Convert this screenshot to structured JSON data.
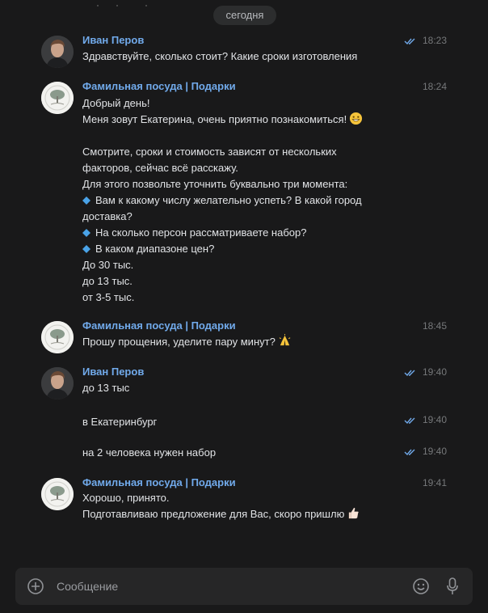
{
  "date_divider": "сегодня",
  "messages": [
    {
      "author": "Иван Перов",
      "time": "18:23",
      "read": true,
      "lines": [
        "Здравствуйте, сколько стоит? Какие сроки изготовления"
      ]
    },
    {
      "author": "Фамильная посуда | Подарки",
      "time": "18:24",
      "read": false,
      "lines": [
        "Добрый день!",
        "Меня зовут Екатерина, очень приятно познакомиться!",
        "",
        "Смотрите, сроки и стоимость зависят от нескольких",
        "факторов, сейчас всё расскажу.",
        "Для этого позвольте уточнить буквально три момента:",
        "Вам к какому числу желательно успеть? В какой город",
        "доставка?",
        "На сколько персон рассматриваете набор?",
        "В каком диапазоне цен?",
        "До 30 тыс.",
        "до 13 тыс.",
        "от 3-5 тыс."
      ]
    },
    {
      "author": "Фамильная посуда | Подарки",
      "time": "18:45",
      "read": false,
      "lines": [
        "Прошу прощения, уделите пару минут?"
      ]
    },
    {
      "author": "Иван Перов",
      "time": "19:40",
      "read": true,
      "lines": [
        "до 13 тыс"
      ]
    },
    {
      "time": "19:40",
      "read": true,
      "lines": [
        "в Екатеринбург"
      ]
    },
    {
      "time": "19:40",
      "read": true,
      "lines": [
        "на 2 человека нужен набор"
      ]
    },
    {
      "author": "Фамильная посуда | Подарки",
      "time": "19:41",
      "read": false,
      "lines": [
        "Хорошо, принято.",
        "Подготавливаю предложение для Вас, скоро пришлю"
      ]
    }
  ],
  "composer": {
    "placeholder": "Сообщение"
  },
  "icons": {
    "add": "plus-circle-icon",
    "emoji": "smile-icon",
    "voice": "microphone-icon",
    "read": "double-check-icon",
    "bullet": "small-blue-diamond-icon"
  },
  "colors": {
    "background": "#19191a",
    "author": "#71aaeb",
    "text": "#e1e3e6",
    "meta": "#76787a",
    "read_tick": "#71aaeb"
  }
}
